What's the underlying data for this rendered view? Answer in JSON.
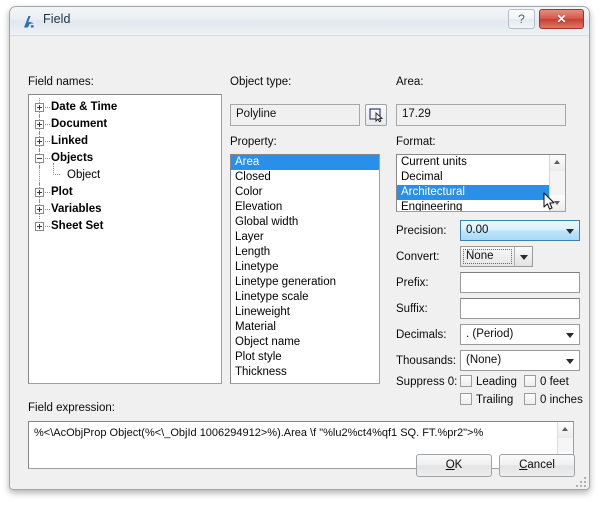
{
  "window": {
    "title": "Field",
    "icon": "autocad-a-icon",
    "help_label": "?",
    "close_label": "✕"
  },
  "left_panel": {
    "label": "Field names:",
    "tree": [
      {
        "label": "Date & Time",
        "expanded": false,
        "level": 0
      },
      {
        "label": "Document",
        "expanded": false,
        "level": 0
      },
      {
        "label": "Linked",
        "expanded": false,
        "level": 0
      },
      {
        "label": "Objects",
        "expanded": true,
        "level": 0
      },
      {
        "label": "Object",
        "expanded": null,
        "level": 1
      },
      {
        "label": "Plot",
        "expanded": false,
        "level": 0
      },
      {
        "label": "Variables",
        "expanded": false,
        "level": 0
      },
      {
        "label": "Sheet Set",
        "expanded": false,
        "level": 0
      }
    ]
  },
  "middle_panel": {
    "object_type_label": "Object type:",
    "object_type_value": "Polyline",
    "pick_button_icon": "select-object-icon",
    "property_label": "Property:",
    "properties": [
      "Area",
      "Closed",
      "Color",
      "Elevation",
      "Global width",
      "Layer",
      "Length",
      "Linetype",
      "Linetype generation",
      "Linetype scale",
      "Lineweight",
      "Material",
      "Object name",
      "Plot style",
      "Thickness"
    ],
    "selected_property": "Area"
  },
  "right_panel": {
    "area_label": "Area:",
    "area_value": "17.29",
    "format_label": "Format:",
    "formats": [
      "Current units",
      "Decimal",
      "Architectural",
      "Engineering"
    ],
    "selected_format": "Architectural",
    "precision_label": "Precision:",
    "precision_value": "0.00",
    "convert_label": "Convert:",
    "convert_value": "None",
    "prefix_label": "Prefix:",
    "prefix_value": "",
    "suffix_label": "Suffix:",
    "suffix_value": "",
    "decimals_label": "Decimals:",
    "decimals_value": ". (Period)",
    "thousands_label": "Thousands:",
    "thousands_value": "(None)",
    "suppress_label": "Suppress 0:",
    "suppress_options": [
      {
        "label": "Leading",
        "checked": false
      },
      {
        "label": "0 feet",
        "checked": false
      },
      {
        "label": "Trailing",
        "checked": false
      },
      {
        "label": "0 inches",
        "checked": false
      }
    ]
  },
  "expression": {
    "label": "Field expression:",
    "value": "%<\\AcObjProp Object(%<\\_ObjId 1006294912>%).Area \\f \"%lu2%ct4%qf1 SQ. FT.%pr2\">%"
  },
  "buttons": {
    "ok": "OK",
    "ok_accel": "O",
    "ok_rest": "K",
    "cancel_accel": "C",
    "cancel_rest": "ancel"
  },
  "colors": {
    "selection_blue": "#2a8fe8",
    "close_red": "#c63f31",
    "dialog_bg": "#f0f0f0",
    "combo_hover": "#bee6fd"
  }
}
